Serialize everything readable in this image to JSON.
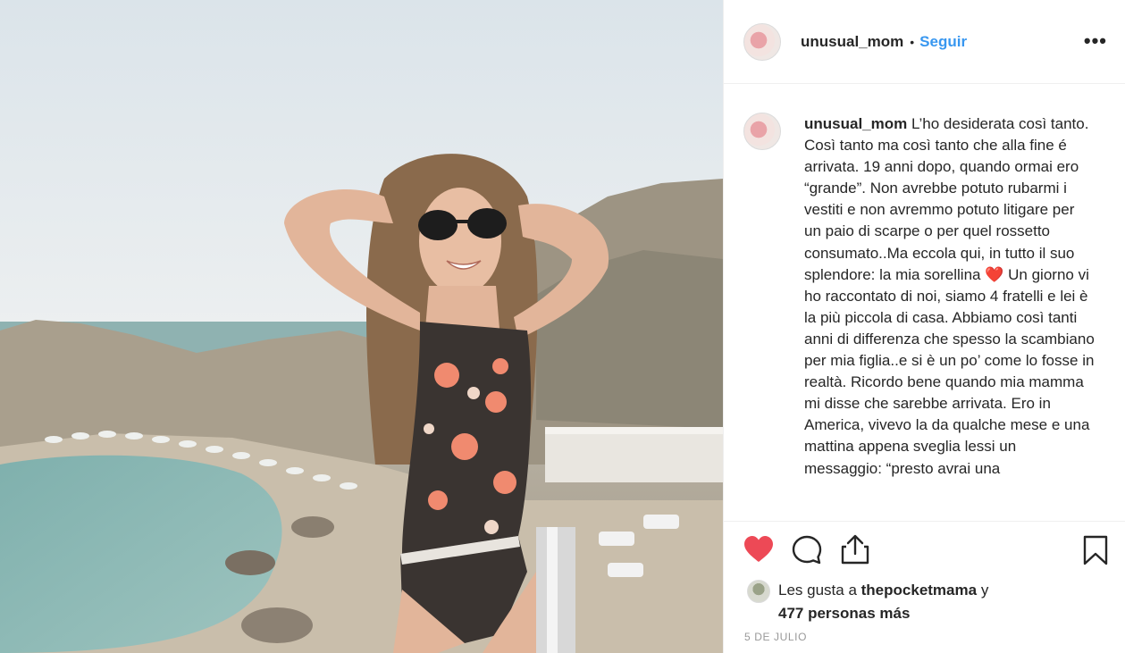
{
  "post": {
    "username": "unusual_mom",
    "separator": "•",
    "follow_label": "Seguir",
    "more_label": "•••"
  },
  "caption": {
    "username": "unusual_mom",
    "text_before_emoji": "L’ho desiderata così tanto. Così tanto ma così tanto che alla fine é arrivata. 19 anni dopo, quando ormai ero “grande”. Non avrebbe potuto rubarmi i vestiti e non avremmo potuto litigare per un paio di scarpe o per quel rossetto consumato..Ma eccola qui, in tutto il suo splendore: la mia sorellina",
    "emoji": "❤️",
    "text_after_emoji": "Un giorno vi ho raccontato di noi, siamo 4 fratelli e lei è la più piccola di casa. Abbiamo così tanti anni di differenza che spesso la scambiano per mia figlia..e si è un po’ come lo fosse in realtà. Ricordo bene quando mia mamma mi disse che sarebbe arrivata. Ero in America, vivevo la da qualche mese e una mattina appena sveglia lessi un messaggio: “presto avrai una"
  },
  "likes": {
    "prefix": "Les gusta a",
    "first_user": "thepocketmama",
    "conjunction": "y",
    "others": "477 personas más"
  },
  "date": "5 DE JULIO",
  "icons": {
    "like": "heart-filled-icon",
    "comment": "comment-bubble-icon",
    "share": "share-icon",
    "save": "bookmark-icon"
  },
  "colors": {
    "accent": "#3897f0",
    "like": "#ed4956",
    "text": "#262626",
    "muted": "#999999"
  }
}
